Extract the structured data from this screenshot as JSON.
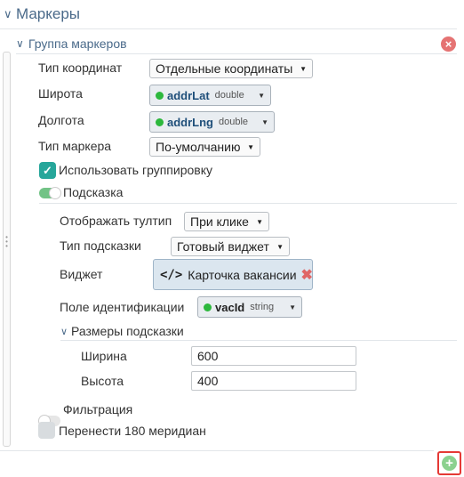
{
  "section": {
    "title": "Маркеры"
  },
  "group": {
    "title": "Группа маркеров"
  },
  "fields": {
    "coord_type": {
      "label": "Тип координат",
      "value": "Отдельные координаты"
    },
    "latitude": {
      "label": "Широта",
      "var": "addrLat",
      "type": "double"
    },
    "longitude": {
      "label": "Долгота",
      "var": "addrLng",
      "type": "double"
    },
    "marker_type": {
      "label": "Тип маркера",
      "value": "По-умолчанию"
    },
    "use_grouping": {
      "label": "Использовать группировку",
      "checked": true
    },
    "hint": {
      "label": "Подсказка",
      "enabled": true
    },
    "tooltip_display": {
      "label": "Отображать тултип",
      "value": "При клике"
    },
    "hint_type": {
      "label": "Тип подсказки",
      "value": "Готовый виджет"
    },
    "widget": {
      "label": "Виджет",
      "value": "Карточка вакансии"
    },
    "id_field": {
      "label": "Поле идентификации",
      "var": "vacId",
      "type": "string"
    },
    "hint_size": {
      "title": "Размеры подсказки",
      "width_label": "Ширина",
      "width_value": "600",
      "height_label": "Высота",
      "height_value": "400"
    },
    "filtering": {
      "label": "Фильтрация",
      "enabled": false
    },
    "meridian": {
      "label": "Перенести 180 меридиан",
      "checked": false
    }
  },
  "icons": {
    "chevron": "chevron-down-icon",
    "close": "close-icon",
    "add": "add-icon",
    "code": "code-icon"
  },
  "colors": {
    "accent": "#26a69a",
    "title": "#4a6a8a",
    "danger": "#e57373",
    "add": "#8bd18f",
    "highlight_border": "#e53935"
  }
}
